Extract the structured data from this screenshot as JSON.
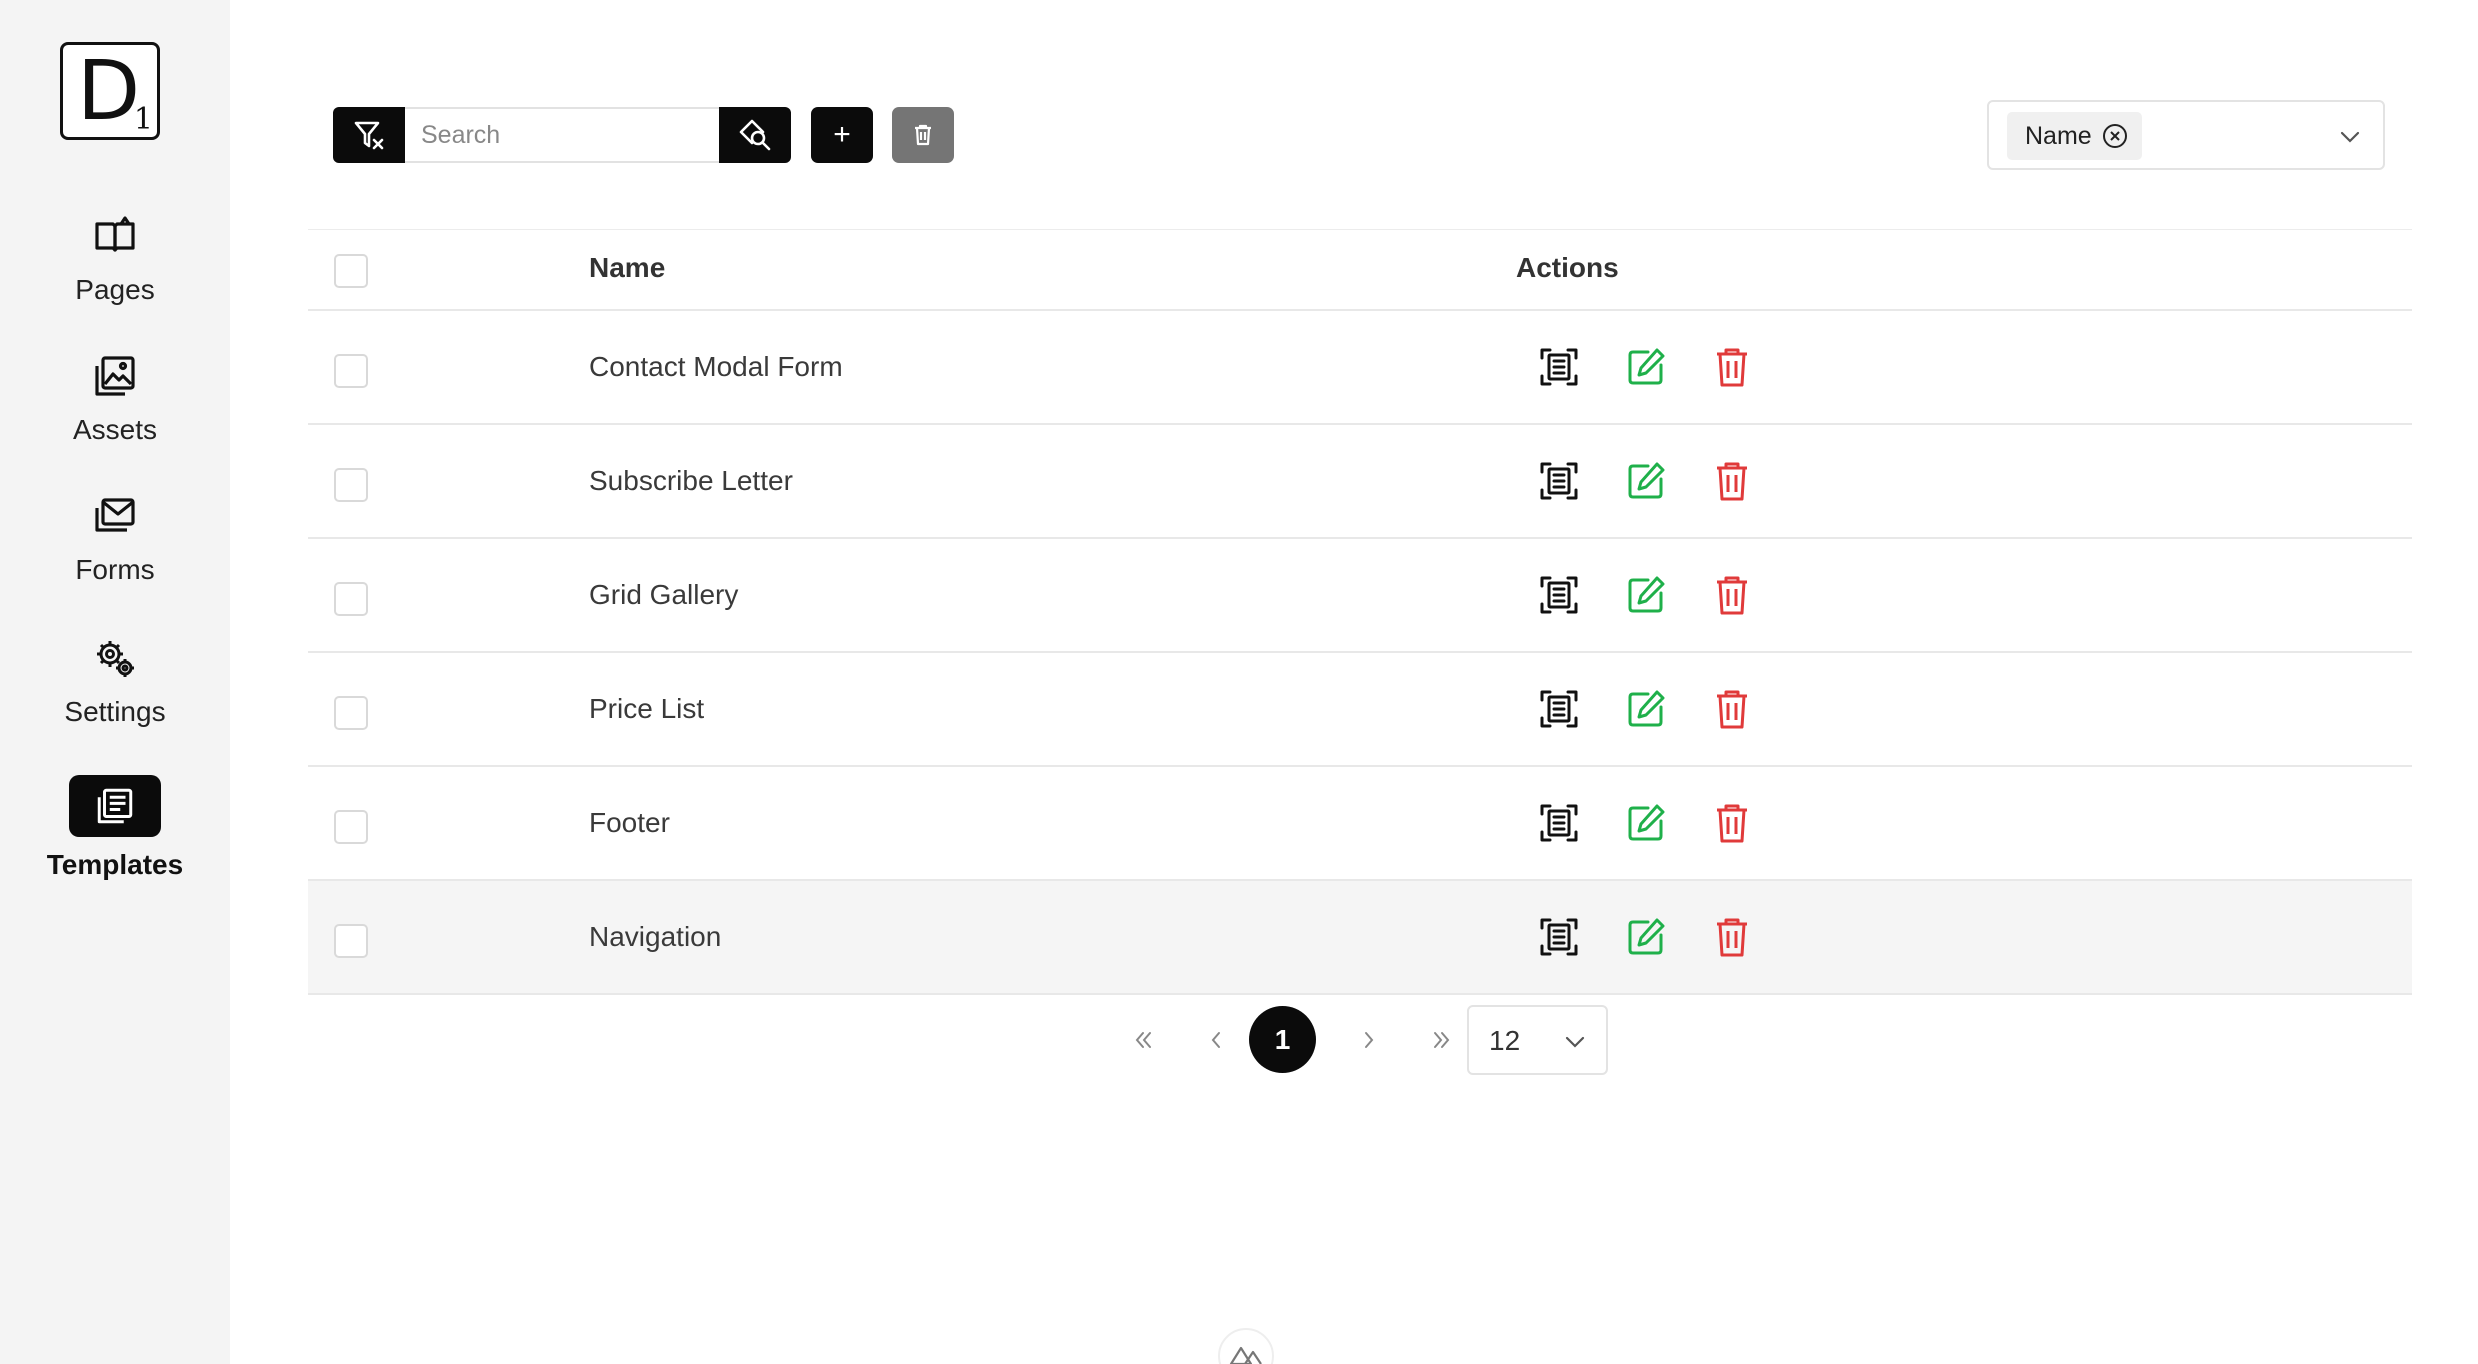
{
  "logo": {
    "letter": "D",
    "subscript": "1"
  },
  "sidebar": {
    "items": [
      {
        "label": "Pages",
        "icon": "book-icon"
      },
      {
        "label": "Assets",
        "icon": "images-icon"
      },
      {
        "label": "Forms",
        "icon": "mail-icon"
      },
      {
        "label": "Settings",
        "icon": "gears-icon"
      },
      {
        "label": "Templates",
        "icon": "template-icon",
        "active": true
      }
    ]
  },
  "toolbar": {
    "search_placeholder": "Search",
    "search_value": "",
    "add_label": "+",
    "clear_filter_icon": "filter-clear-icon",
    "search_icon": "search-icon",
    "delete_icon": "trash-icon"
  },
  "columns_select": {
    "chip_label": "Name"
  },
  "table": {
    "headers": {
      "name": "Name",
      "actions": "Actions"
    },
    "rows": [
      {
        "name": "Contact Modal Form"
      },
      {
        "name": "Subscribe Letter"
      },
      {
        "name": "Grid Gallery"
      },
      {
        "name": "Price List"
      },
      {
        "name": "Footer"
      },
      {
        "name": "Navigation"
      }
    ]
  },
  "pagination": {
    "current": "1",
    "page_size": "12"
  },
  "colors": {
    "primary": "#0b0b0b",
    "edit": "#1fb04a",
    "delete": "#e03a3a",
    "sidebar_bg": "#f4f4f4",
    "disabled": "#757575"
  }
}
